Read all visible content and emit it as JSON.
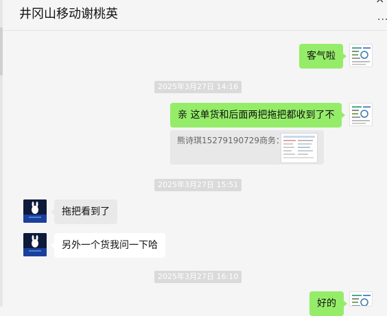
{
  "header": {
    "title": "井冈山移动谢桃英",
    "more_label": "..."
  },
  "messages": [
    {
      "direction": "outgoing",
      "text": "客气啦"
    },
    {
      "timestamp": "2025年3月27日 14:16"
    },
    {
      "direction": "outgoing",
      "text": "亲 这单货和后面两把拖把都收到了不",
      "quote": {
        "sender_text": "熊诗琪15279190729商务：",
        "icon": "document-thumbnail-icon"
      }
    },
    {
      "timestamp": "2025年3月27日 15:51"
    },
    {
      "direction": "incoming",
      "text": "拖把看到了"
    },
    {
      "direction": "incoming",
      "text": "另外一个货我问一下哈"
    },
    {
      "timestamp": "2025年3月27日 16:10"
    },
    {
      "direction": "outgoing",
      "text": "好的"
    }
  ],
  "colors": {
    "outgoing_bubble": "#95ec69",
    "incoming_bubble": "#ffffff",
    "background": "#f5f5f5",
    "timestamp_bg": "#dadada"
  }
}
